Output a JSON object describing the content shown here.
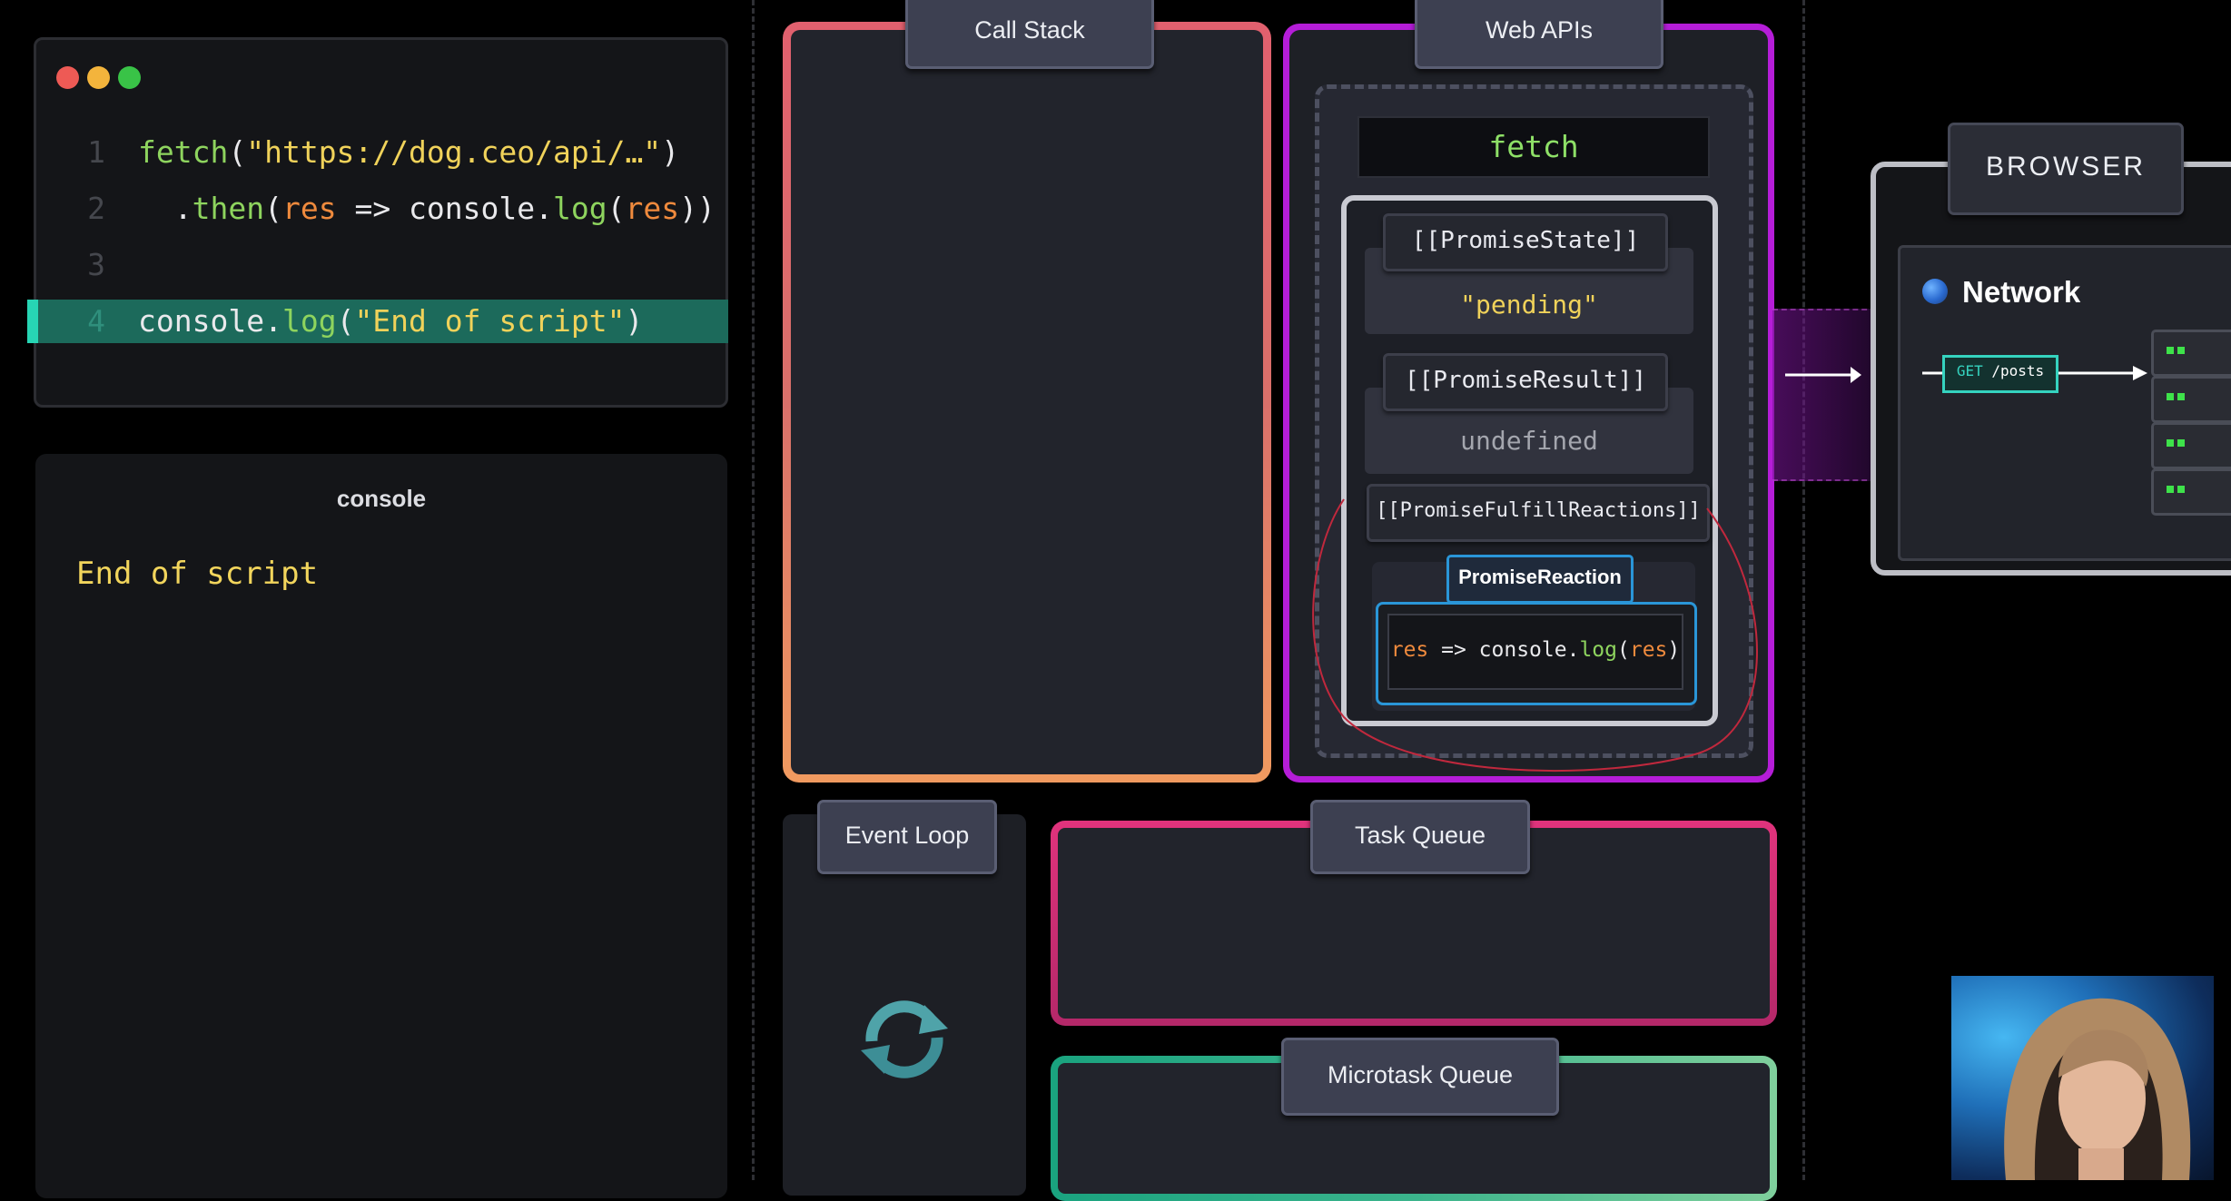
{
  "editor": {
    "window_controls": [
      "close",
      "minimize",
      "maximize"
    ],
    "lines": [
      {
        "number": "1",
        "tokens": [
          {
            "t": "fetch",
            "k": "fn"
          },
          {
            "t": "(",
            "k": "pl"
          },
          {
            "t": "\"https://dog.ceo/api/…\"",
            "k": "str"
          },
          {
            "t": ")",
            "k": "pl"
          }
        ]
      },
      {
        "number": "2",
        "tokens": [
          {
            "t": "  .",
            "k": "pl"
          },
          {
            "t": "then",
            "k": "fn"
          },
          {
            "t": "(",
            "k": "pl"
          },
          {
            "t": "res",
            "k": "var"
          },
          {
            "t": " => console.",
            "k": "pl"
          },
          {
            "t": "log",
            "k": "fn"
          },
          {
            "t": "(",
            "k": "pl"
          },
          {
            "t": "res",
            "k": "var"
          },
          {
            "t": "))",
            "k": "pl"
          }
        ]
      },
      {
        "number": "3",
        "tokens": []
      },
      {
        "number": "4",
        "tokens": [
          {
            "t": "console.",
            "k": "pl"
          },
          {
            "t": "log",
            "k": "fn"
          },
          {
            "t": "(",
            "k": "pl"
          },
          {
            "t": "\"End of script\"",
            "k": "str"
          },
          {
            "t": ")",
            "k": "pl"
          }
        ]
      }
    ],
    "active_line": 4
  },
  "console": {
    "title": "console",
    "output": "End of script"
  },
  "call_stack": {
    "label": "Call Stack"
  },
  "web_apis": {
    "label": "Web APIs",
    "fetch_label": "fetch",
    "promise": {
      "state_label": "[[PromiseState]]",
      "state_value": "\"pending\"",
      "result_label": "[[PromiseResult]]",
      "result_value": "undefined",
      "reactions_label": "[[PromiseFulfillReactions]]",
      "reaction_label": "PromiseReaction",
      "reaction_tokens": [
        {
          "t": "res",
          "k": "var"
        },
        {
          "t": " => console.",
          "k": "pl"
        },
        {
          "t": "log",
          "k": "fn"
        },
        {
          "t": "(",
          "k": "pl"
        },
        {
          "t": "res",
          "k": "var"
        },
        {
          "t": ")",
          "k": "pl"
        }
      ]
    }
  },
  "browser": {
    "label": "BROWSER",
    "network_label": "Network",
    "request_method": "GET",
    "request_path": "/posts",
    "server_count": 4
  },
  "event_loop": {
    "label": "Event Loop"
  },
  "task_queue": {
    "label": "Task Queue"
  },
  "microtask_queue": {
    "label": "Microtask Queue"
  },
  "colors": {
    "code_fn": "#8ed45e",
    "code_str": "#f0d25a",
    "code_var": "#ef8a3d",
    "active_line_bg": "#1c6a5b",
    "call_stack_border": "#e1606e",
    "web_apis_border": "#b51dd8",
    "task_queue_border": "#e0337c",
    "microtask_queue_border": "#1aa37f",
    "reaction_border": "#2a96d8"
  }
}
